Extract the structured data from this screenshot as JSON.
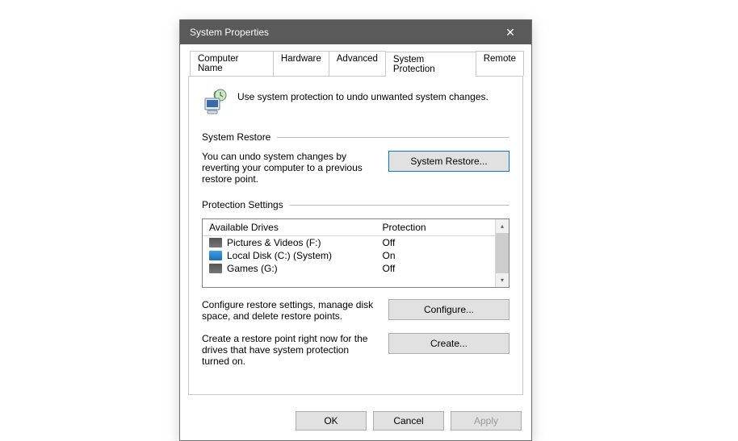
{
  "window": {
    "title": "System Properties"
  },
  "tabs": [
    {
      "label": "Computer Name"
    },
    {
      "label": "Hardware"
    },
    {
      "label": "Advanced"
    },
    {
      "label": "System Protection"
    },
    {
      "label": "Remote"
    }
  ],
  "intro": {
    "text": "Use system protection to undo unwanted system changes."
  },
  "group_restore": {
    "legend": "System Restore",
    "desc": "You can undo system changes by reverting your computer to a previous restore point.",
    "button": "System Restore..."
  },
  "group_protection": {
    "legend": "Protection Settings",
    "col_drive": "Available Drives",
    "col_prot": "Protection",
    "drives": [
      {
        "label": "Pictures & Videos (F:)",
        "protection": "Off",
        "system": false
      },
      {
        "label": "Local Disk (C:) (System)",
        "protection": "On",
        "system": true
      },
      {
        "label": "Games (G:)",
        "protection": "Off",
        "system": false
      }
    ],
    "configure_desc": "Configure restore settings, manage disk space, and delete restore points.",
    "configure_btn": "Configure...",
    "create_desc": "Create a restore point right now for the drives that have system protection turned on.",
    "create_btn": "Create..."
  },
  "footer": {
    "ok": "OK",
    "cancel": "Cancel",
    "apply": "Apply"
  }
}
